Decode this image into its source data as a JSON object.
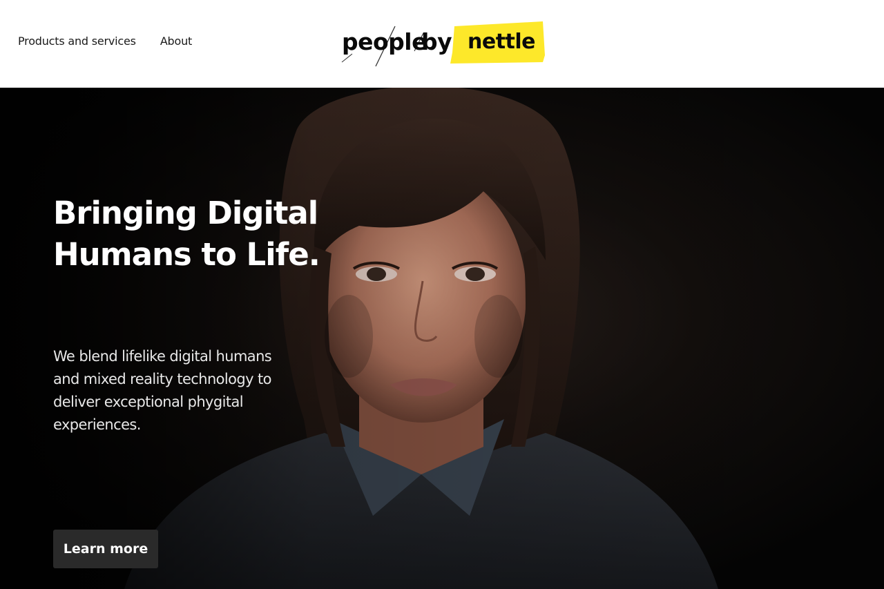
{
  "nav": {
    "items": [
      {
        "label": "Products and services"
      },
      {
        "label": "About"
      }
    ]
  },
  "logo": {
    "part1": "people",
    "part2": "by",
    "part3": "nettle",
    "highlight_color": "#fde82a"
  },
  "hero": {
    "title_line1": "Bringing Digital",
    "title_line2": "Humans to Life.",
    "description": "We blend lifelike digital humans and mixed reality technology to deliver exceptional phygital experiences.",
    "cta_label": "Learn more",
    "image": "digital-human-portrait"
  }
}
